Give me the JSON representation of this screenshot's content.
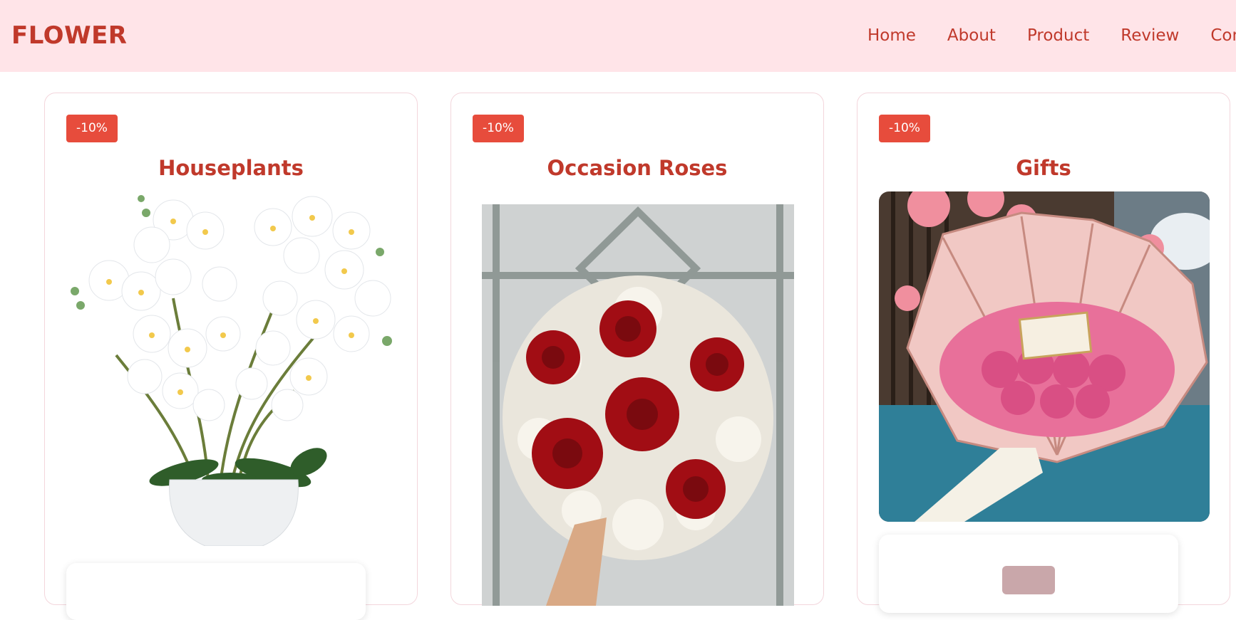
{
  "header": {
    "logo": "FLOWER",
    "nav": [
      "Home",
      "About",
      "Product",
      "Review",
      "Cont"
    ]
  },
  "cards": [
    {
      "badge": "-10%",
      "title": "Houseplants",
      "image": "white-orchid-pot-image"
    },
    {
      "badge": "-10%",
      "title": "Occasion Roses",
      "image": "red-roses-bouquet-image"
    },
    {
      "badge": "-10%",
      "title": "Gifts",
      "image": "pink-roses-gift-bouquet-image"
    }
  ],
  "colors": {
    "header_bg": "#ffe4e8",
    "accent": "#c0392b",
    "badge_bg": "#e74c3c"
  }
}
